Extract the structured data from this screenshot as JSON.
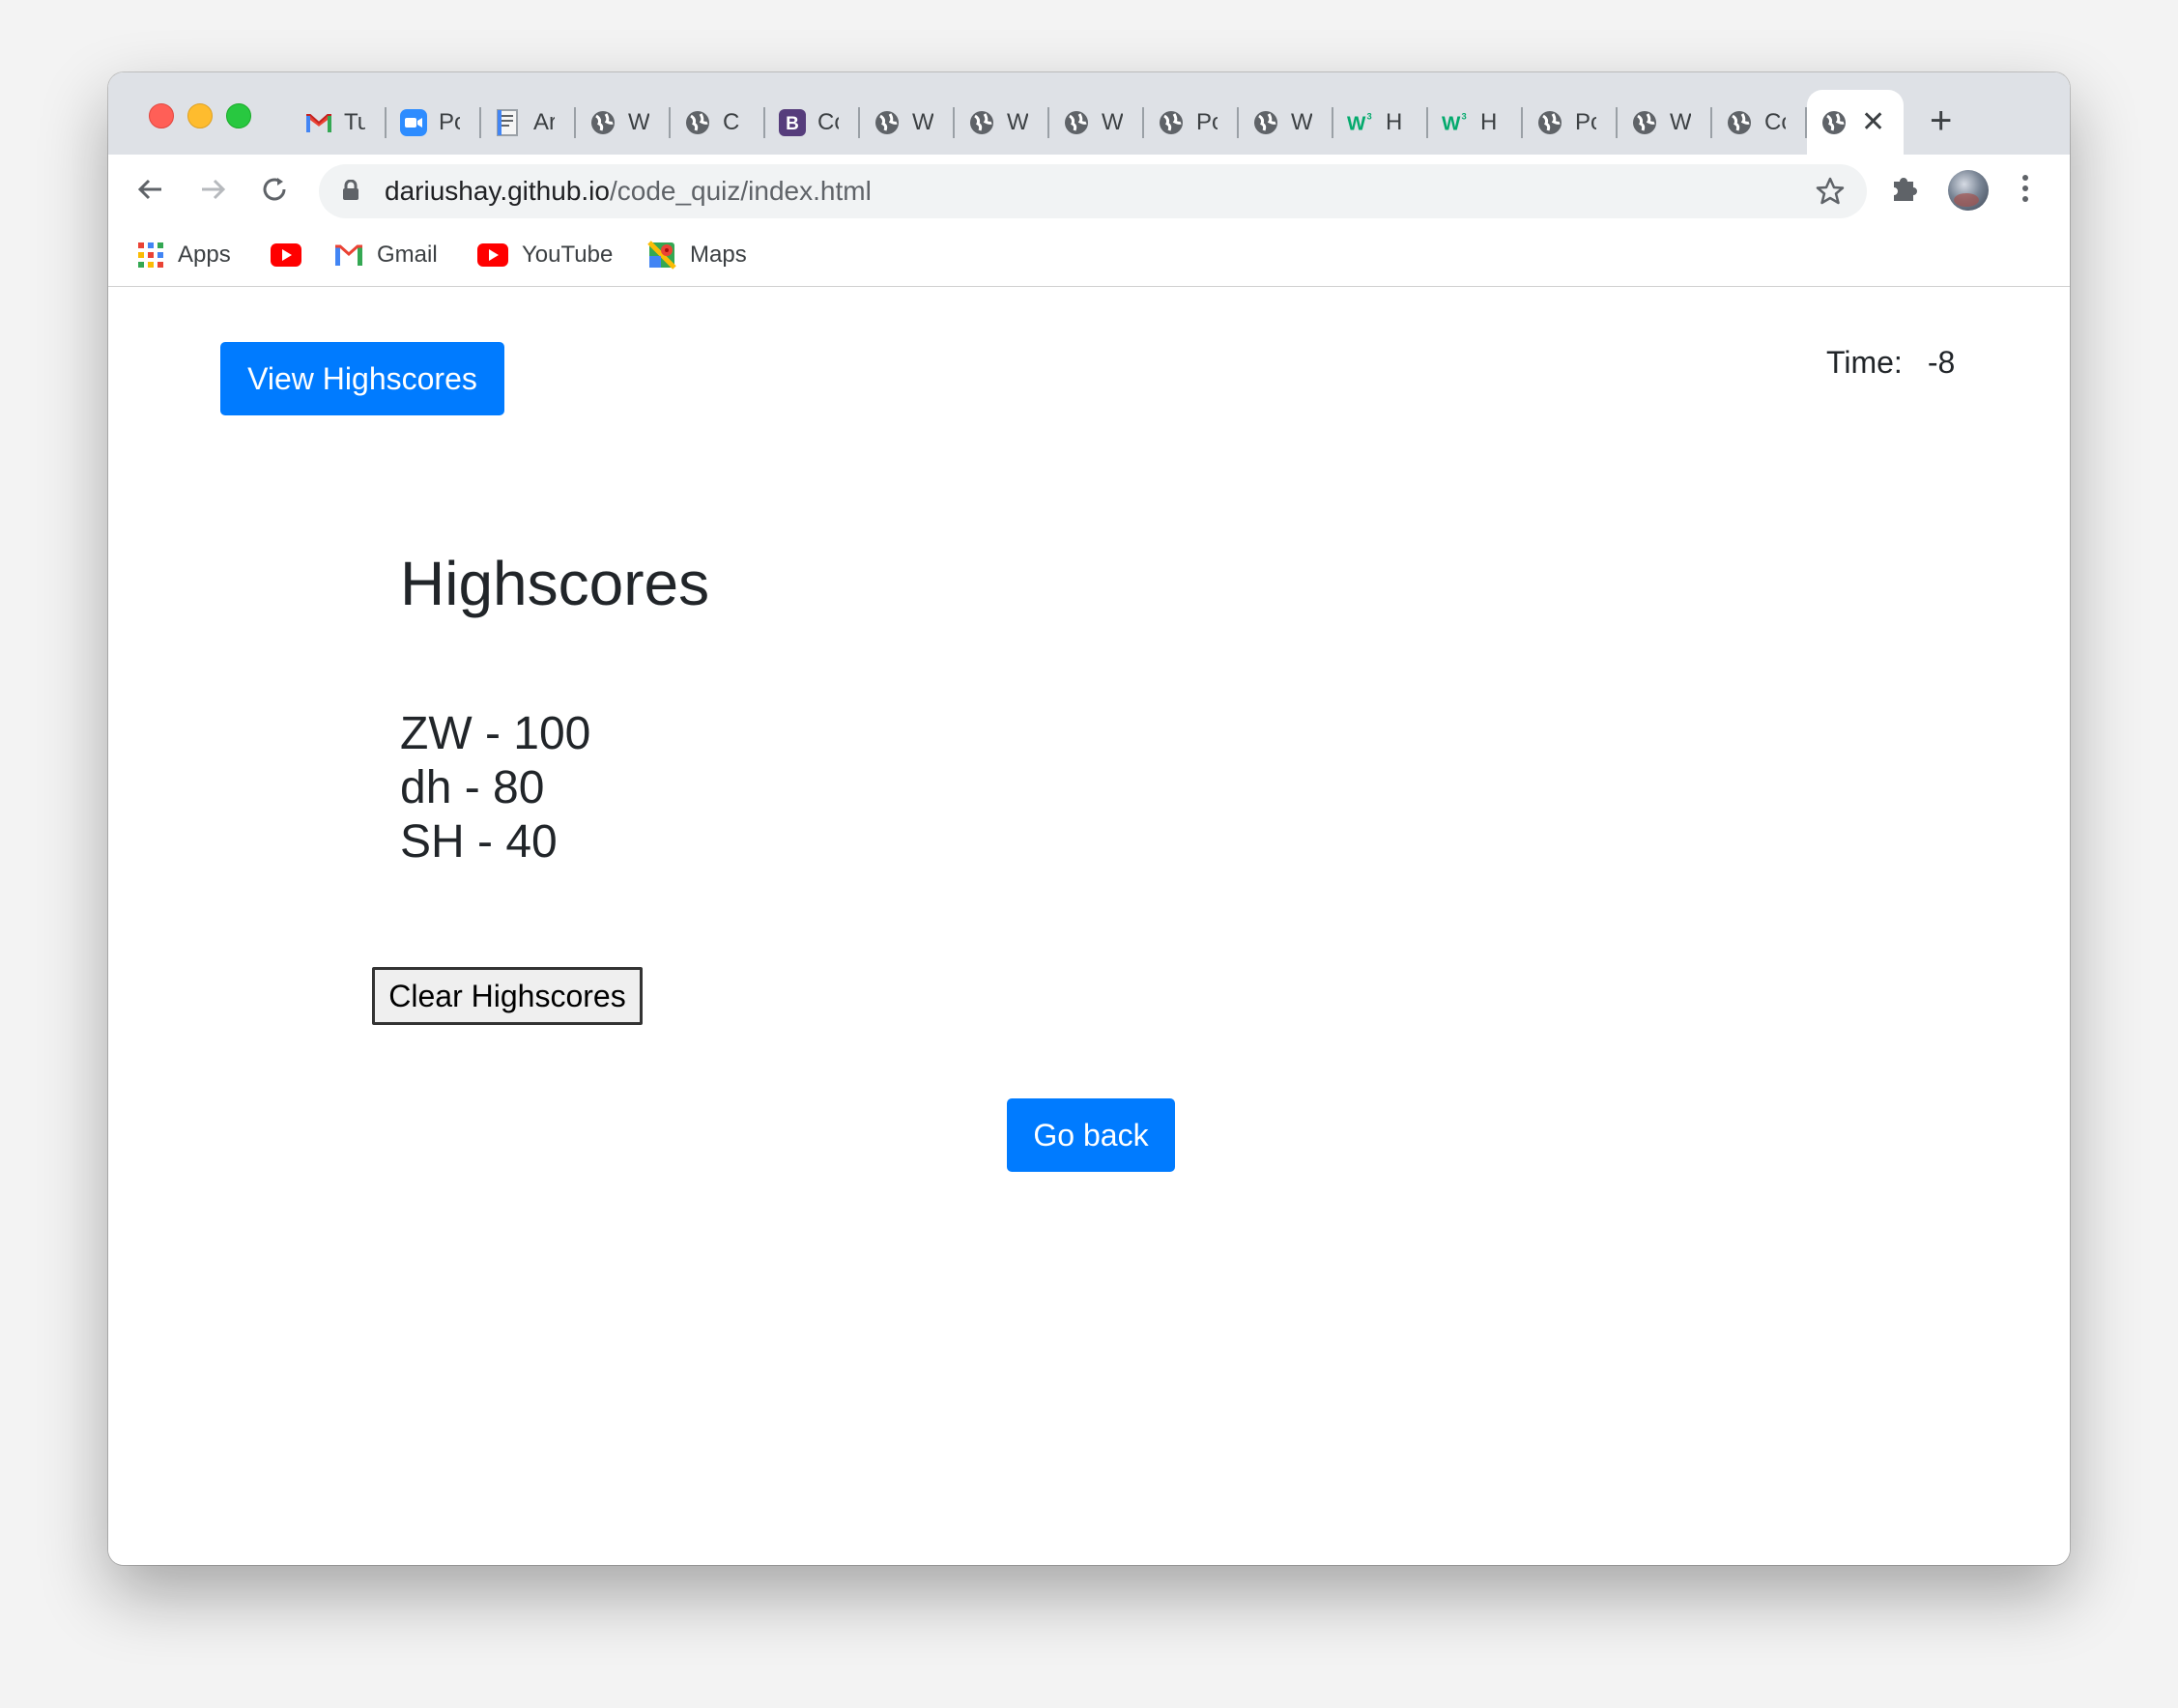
{
  "browser": {
    "tabs": [
      {
        "title": "Tu",
        "icon": "gmail-icon"
      },
      {
        "title": "Po",
        "icon": "zoom-icon"
      },
      {
        "title": "Ar",
        "icon": "document-icon"
      },
      {
        "title": "W",
        "icon": "globe-icon"
      },
      {
        "title": "C",
        "icon": "globe-icon"
      },
      {
        "title": "Co",
        "icon": "bootstrap-icon"
      },
      {
        "title": "W",
        "icon": "globe-icon"
      },
      {
        "title": "W",
        "icon": "globe-icon"
      },
      {
        "title": "W",
        "icon": "globe-icon"
      },
      {
        "title": "Po",
        "icon": "globe-icon"
      },
      {
        "title": "W",
        "icon": "globe-icon"
      },
      {
        "title": "H",
        "icon": "w3schools-icon"
      },
      {
        "title": "H",
        "icon": "w3schools-icon"
      },
      {
        "title": "Po",
        "icon": "globe-icon"
      },
      {
        "title": "W",
        "icon": "globe-icon"
      },
      {
        "title": "Co",
        "icon": "globe-icon"
      }
    ],
    "active_tab": {
      "icon": "globe-icon",
      "close": "✕"
    },
    "new_tab_label": "+",
    "url_host": "dariushay.github.io",
    "url_path": "/code_quiz/index.html",
    "bookmarks": [
      {
        "label": "Apps",
        "icon": "apps-grid-icon"
      },
      {
        "label": "",
        "icon": "youtube-icon"
      },
      {
        "label": "Gmail",
        "icon": "gmail-icon"
      },
      {
        "label": "YouTube",
        "icon": "youtube-icon"
      },
      {
        "label": "Maps",
        "icon": "maps-icon"
      }
    ]
  },
  "page": {
    "view_highscores_label": "View Highscores",
    "timer_label": "Time:",
    "timer_value": "-8",
    "highscores_title": "Highscores",
    "scores": [
      "ZW - 100",
      "dh - 80",
      "SH - 40"
    ],
    "clear_label": "Clear Highscores",
    "go_back_label": "Go back"
  },
  "colors": {
    "primary_button": "#007bff",
    "tab_strip": "#dee1e6",
    "omnibox": "#f1f3f4",
    "text": "#212529"
  }
}
